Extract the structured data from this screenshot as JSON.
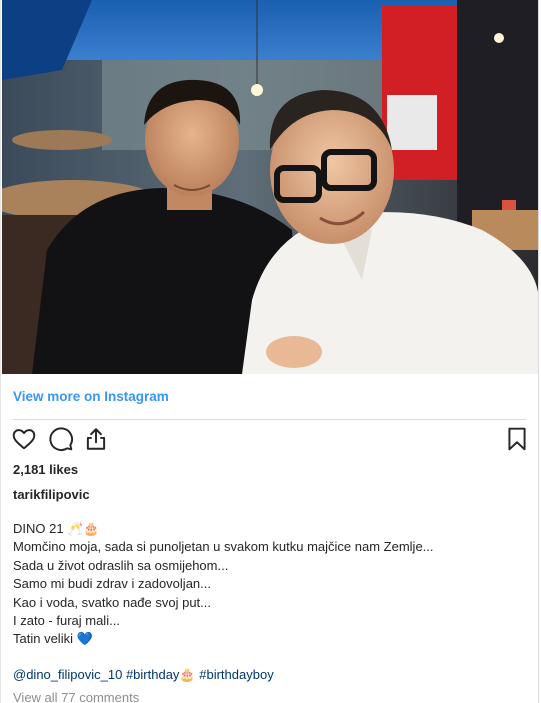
{
  "post": {
    "view_more_label": "View more on Instagram",
    "likes_text": "2,181 likes",
    "username": "tarikfilipovic",
    "caption_lines": [
      "DINO 21 🥂🎂",
      "Momčino moja, sada si punoljetan u svakom kutku majčice nam Zemlje...",
      "Sada u život odraslih sa osmijehom...",
      "Samo mi budi zdrav i zadovoljan...",
      "Kao i voda, svatko nađe svoj put...",
      "I zato - furaj mali...",
      "Tatin veliki 💙"
    ],
    "mention": "@dino_filipovic_10",
    "hashtag_1": "#birthday🎂",
    "hashtag_2": "#birthdayboy",
    "comments_link": "View all 77 comments"
  },
  "icons": {
    "like": "heart-icon",
    "comment": "comment-bubble-icon",
    "share": "share-icon",
    "save": "bookmark-icon"
  },
  "colors": {
    "link_blue": "#3897f0",
    "tag_blue": "#00376b",
    "muted": "#8e8e8e",
    "text": "#262626",
    "divider": "#dbdbdb"
  }
}
